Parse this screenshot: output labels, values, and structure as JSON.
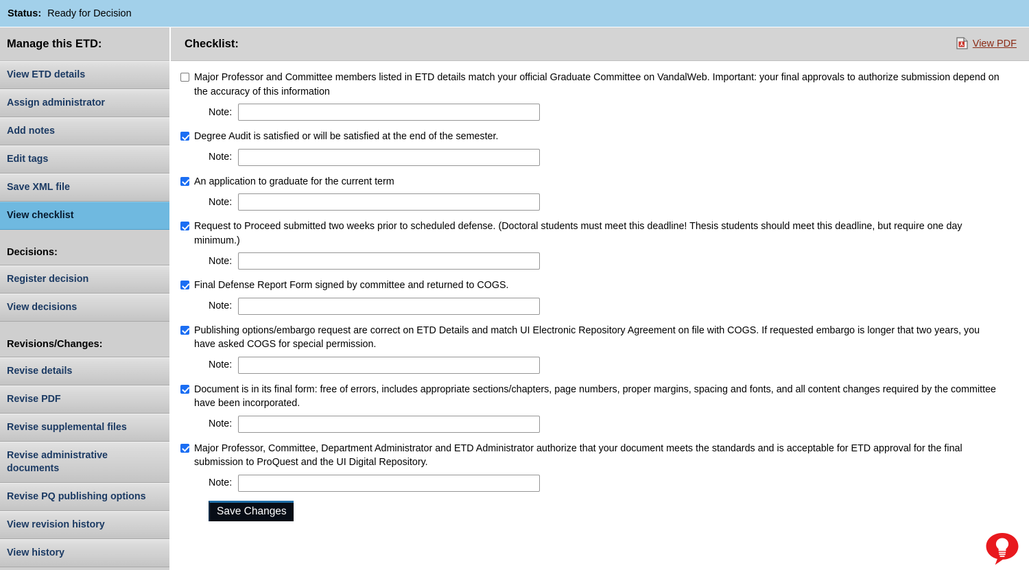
{
  "status": {
    "label": "Status",
    "colon": ":",
    "value": "Ready for Decision"
  },
  "sidebar": {
    "header": "Manage this ETD:",
    "items": [
      {
        "label": "View ETD details",
        "selected": false
      },
      {
        "label": "Assign administrator",
        "selected": false
      },
      {
        "label": "Add notes",
        "selected": false
      },
      {
        "label": "Edit tags",
        "selected": false
      },
      {
        "label": "Save XML file",
        "selected": false
      },
      {
        "label": "View checklist",
        "selected": true
      }
    ],
    "decisions_section": "Decisions:",
    "decisions_items": [
      {
        "label": "Register decision",
        "selected": false
      },
      {
        "label": "View decisions",
        "selected": false
      }
    ],
    "revisions_section": "Revisions/Changes:",
    "revisions_items": [
      {
        "label": "Revise details",
        "selected": false
      },
      {
        "label": "Revise PDF",
        "selected": false
      },
      {
        "label": "Revise supplemental files",
        "selected": false
      },
      {
        "label": "Revise administrative documents",
        "selected": false
      },
      {
        "label": "Revise PQ publishing options",
        "selected": false
      },
      {
        "label": "View revision history",
        "selected": false
      },
      {
        "label": "View history",
        "selected": false
      }
    ]
  },
  "content": {
    "title": "Checklist:",
    "view_pdf_label": "View PDF",
    "view_pdf_icon": "pdf-document-icon",
    "note_label": "Note:",
    "note_placeholder": "",
    "save_label": "Save Changes",
    "items": [
      {
        "checked": false,
        "text": "Major Professor and Committee members listed in ETD details match your official Graduate Committee on VandalWeb. Important: your final approvals to authorize submission depend on the accuracy of this information",
        "note_value": ""
      },
      {
        "checked": true,
        "text": "Degree Audit is satisfied or will be satisfied at the end of the semester.",
        "note_value": ""
      },
      {
        "checked": true,
        "text": "An application to graduate for the current term",
        "note_value": ""
      },
      {
        "checked": true,
        "text": "Request to Proceed submitted two weeks prior to scheduled defense. (Doctoral students must meet this deadline! Thesis students should meet this deadline, but require one day minimum.)",
        "note_value": ""
      },
      {
        "checked": true,
        "text": "Final Defense Report Form signed by committee and returned to COGS.",
        "note_value": ""
      },
      {
        "checked": true,
        "text": "Publishing options/embargo request are correct on ETD Details and match UI Electronic Repository Agreement on file with COGS. If requested embargo is longer that two years, you have asked COGS for special permission.",
        "note_value": ""
      },
      {
        "checked": true,
        "text": "Document is in its final form: free of errors, includes appropriate sections/chapters, page numbers, proper margins, spacing and fonts, and all content changes required by the committee have been incorporated.",
        "note_value": ""
      },
      {
        "checked": true,
        "text": "Major Professor, Committee, Department Administrator and ETD Administrator authorize that your document meets the standards and is acceptable for ETD approval for the final submission to ProQuest and the UI Digital Repository.",
        "note_value": ""
      }
    ]
  },
  "feedback": {
    "icon": "feedback-lightbulb-icon",
    "color": "#e8191e"
  },
  "colors": {
    "status_bar": "#a2d0ea",
    "sidebar_selected": "#6fb9e0",
    "link": "#8b2b16",
    "checkbox_checked": "#1b6ef3",
    "sidebar_text": "#1b3a63"
  }
}
